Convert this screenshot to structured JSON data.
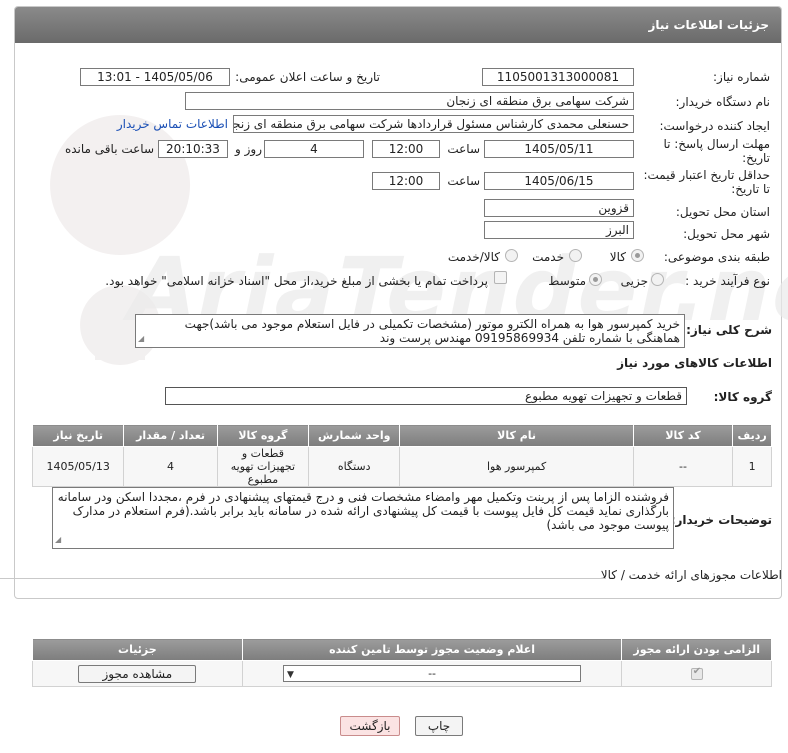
{
  "header": {
    "title": "جزئیات اطلاعات نیاز"
  },
  "form": {
    "need_number_label": "شماره نیاز:",
    "need_number": "1105001313000081",
    "announce_label": "تاریخ و ساعت اعلان عمومی:",
    "announce_value": "1405/05/06 - 13:01",
    "buyer_label": "نام دستگاه خریدار:",
    "buyer_value": "شرکت سهامی برق منطقه ای زنجان",
    "creator_label": "ایجاد کننده درخواست:",
    "creator_value": "حسنعلی محمدی کارشناس مسئول قراردادها شرکت سهامی برق منطقه ای زنجان",
    "contact_link": "اطلاعات تماس خریدار",
    "deadline_label_1": "مهلت ارسال پاسخ: تا",
    "deadline_label_2": "تاریخ:",
    "deadline_date": "1405/05/11",
    "time_label": "ساعت",
    "deadline_time": "12:00",
    "days_value": "4",
    "days_label": "روز و",
    "remaining_time": "20:10:33",
    "remaining_label": "ساعت باقی مانده",
    "validity_label_1": "حداقل تاریخ اعتبار قیمت:",
    "validity_label_2": "تا تاریخ:",
    "validity_date": "1405/06/15",
    "validity_time": "12:00",
    "province_label": "استان محل تحویل:",
    "province_value": "قزوین",
    "city_label": "شهر محل تحویل:",
    "city_value": "البرز",
    "category_label": "طبقه بندی موضوعی:",
    "category_options": [
      "کالا",
      "خدمت",
      "کالا/خدمت"
    ],
    "category_selected": "کالا",
    "process_label": "نوع فرآیند خرید :",
    "process_options": [
      "جزیی",
      "متوسط"
    ],
    "process_selected": "متوسط",
    "treasury_note": "پرداخت تمام یا بخشی از مبلغ خرید،از محل \"اسناد خزانه اسلامی\" خواهد بود."
  },
  "description": {
    "label": "شرح کلی نیاز:",
    "text": "خرید کمپرسور هوا به همراه الکترو موتور (مشخصات تکمیلی در فایل استعلام موجود می باشد)جهت هماهنگی با شماره تلفن 09195869934 مهندس پرست وند"
  },
  "goods": {
    "section_title": "اطلاعات کالاهای مورد نیاز",
    "group_label": "گروه کالا:",
    "group_value": "قطعات و تجهیزات تهویه مطبوع",
    "columns": [
      "ردیف",
      "کد کالا",
      "نام کالا",
      "واحد شمارش",
      "گروه کالا",
      "تعداد / مقدار",
      "تاریخ نیاز"
    ],
    "rows": [
      {
        "row": "1",
        "code": "--",
        "name": "کمپرسور هوا",
        "unit": "دستگاه",
        "group": "قطعات و تجهیزات تهویه مطبوع",
        "qty": "4",
        "date": "1405/05/13"
      }
    ]
  },
  "buyer_notes": {
    "label": "توضیحات خریدار:",
    "text": "فروشنده الزاما پس از پرینت وتکمیل مهر وامضاء مشخصات فنی و درج قیمتهای پیشنهادی در فرم ،مجددا اسکن ودر سامانه بارگذاری نماید قیمت کل فایل پیوست با قیمت کل پیشنهادی ارائه شده در سامانه باید برابر باشد.(فرم استعلام در مدارک پیوست موجود می باشد)"
  },
  "permits": {
    "section_title": "اطلاعات مجوزهای ارائه خدمت / کالا",
    "columns": [
      "الزامی بودن ارائه مجوز",
      "اعلام وضعیت مجوز توسط تامین کننده",
      "جزئیات"
    ],
    "select_value": "--",
    "view_button": "مشاهده مجوز"
  },
  "footer": {
    "print_button": "چاپ",
    "back_button": "بازگشت"
  },
  "icons": {
    "select_arrow": "chevron-down-icon",
    "checkmark": "check-icon"
  }
}
